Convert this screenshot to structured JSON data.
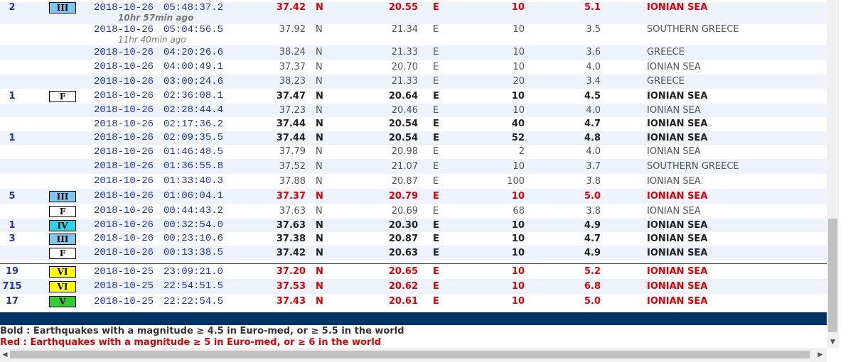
{
  "rows": [
    {
      "felt": "2",
      "intensity": "III",
      "int_color": "#7ec8f0",
      "date": "2018-10-26",
      "time": "05:48:37.2",
      "ago": "10hr 57min ago",
      "lat": "37.42",
      "ns": "N",
      "lon": "20.55",
      "ew": "E",
      "depth": "10",
      "mag": "5.1",
      "region": "IONIAN SEA",
      "style": "red"
    },
    {
      "felt": "",
      "intensity": "",
      "date": "2018-10-26",
      "time": "05:04:56.5",
      "ago": "11hr 40min ago",
      "lat": "37.92",
      "ns": "N",
      "lon": "21.34",
      "ew": "E",
      "depth": "10",
      "mag": "3.5",
      "region": "SOUTHERN GREECE",
      "style": "normal"
    },
    {
      "felt": "",
      "intensity": "",
      "date": "2018-10-26",
      "time": "04:20:26.6",
      "lat": "38.24",
      "ns": "N",
      "lon": "21.33",
      "ew": "E",
      "depth": "10",
      "mag": "3.6",
      "region": "GREECE",
      "style": "normal"
    },
    {
      "felt": "",
      "intensity": "",
      "date": "2018-10-26",
      "time": "04:00:49.1",
      "lat": "37.37",
      "ns": "N",
      "lon": "20.70",
      "ew": "E",
      "depth": "10",
      "mag": "4.0",
      "region": "IONIAN SEA",
      "style": "normal"
    },
    {
      "felt": "",
      "intensity": "",
      "date": "2018-10-26",
      "time": "03:00:24.6",
      "lat": "38.23",
      "ns": "N",
      "lon": "21.33",
      "ew": "E",
      "depth": "20",
      "mag": "3.4",
      "region": "GREECE",
      "style": "normal"
    },
    {
      "felt": "1",
      "intensity": "F",
      "int_color": "#ffffff",
      "date": "2018-10-26",
      "time": "02:36:08.1",
      "lat": "37.47",
      "ns": "N",
      "lon": "20.64",
      "ew": "E",
      "depth": "10",
      "mag": "4.5",
      "region": "IONIAN SEA",
      "style": "bold"
    },
    {
      "felt": "",
      "intensity": "",
      "date": "2018-10-26",
      "time": "02:28:44.4",
      "lat": "37.23",
      "ns": "N",
      "lon": "20.46",
      "ew": "E",
      "depth": "10",
      "mag": "4.0",
      "region": "IONIAN SEA",
      "style": "normal"
    },
    {
      "felt": "",
      "intensity": "",
      "date": "2018-10-26",
      "time": "02:17:36.2",
      "lat": "37.44",
      "ns": "N",
      "lon": "20.54",
      "ew": "E",
      "depth": "40",
      "mag": "4.7",
      "region": "IONIAN SEA",
      "style": "bold"
    },
    {
      "felt": "1",
      "intensity": "",
      "date": "2018-10-26",
      "time": "02:09:35.5",
      "lat": "37.44",
      "ns": "N",
      "lon": "20.54",
      "ew": "E",
      "depth": "52",
      "mag": "4.8",
      "region": "IONIAN SEA",
      "style": "bold"
    },
    {
      "felt": "",
      "intensity": "",
      "date": "2018-10-26",
      "time": "01:46:48.5",
      "lat": "37.79",
      "ns": "N",
      "lon": "20.98",
      "ew": "E",
      "depth": "2",
      "mag": "4.0",
      "region": "IONIAN SEA",
      "style": "normal"
    },
    {
      "felt": "",
      "intensity": "",
      "date": "2018-10-26",
      "time": "01:36:55.8",
      "lat": "37.52",
      "ns": "N",
      "lon": "21.07",
      "ew": "E",
      "depth": "10",
      "mag": "3.7",
      "region": "SOUTHERN GREECE",
      "style": "normal"
    },
    {
      "felt": "",
      "intensity": "",
      "date": "2018-10-26",
      "time": "01:33:40.3",
      "lat": "37.88",
      "ns": "N",
      "lon": "20.87",
      "ew": "E",
      "depth": "100",
      "mag": "3.8",
      "region": "IONIAN SEA",
      "style": "normal"
    },
    {
      "felt": "5",
      "intensity": "III",
      "int_color": "#7ec8f0",
      "date": "2018-10-26",
      "time": "01:06:04.1",
      "lat": "37.37",
      "ns": "N",
      "lon": "20.79",
      "ew": "E",
      "depth": "10",
      "mag": "5.0",
      "region": "IONIAN SEA",
      "style": "red"
    },
    {
      "felt": "",
      "intensity": "F",
      "int_color": "#ffffff",
      "date": "2018-10-26",
      "time": "00:44:43.2",
      "lat": "37.63",
      "ns": "N",
      "lon": "20.69",
      "ew": "E",
      "depth": "68",
      "mag": "3.8",
      "region": "IONIAN SEA",
      "style": "normal"
    },
    {
      "felt": "1",
      "intensity": "IV",
      "int_color": "#2ed2e8",
      "date": "2018-10-26",
      "time": "00:32:54.0",
      "lat": "37.63",
      "ns": "N",
      "lon": "20.30",
      "ew": "E",
      "depth": "10",
      "mag": "4.9",
      "region": "IONIAN SEA",
      "style": "bold"
    },
    {
      "felt": "3",
      "intensity": "III",
      "int_color": "#7ec8f0",
      "date": "2018-10-26",
      "time": "00:23:10.6",
      "lat": "37.38",
      "ns": "N",
      "lon": "20.87",
      "ew": "E",
      "depth": "10",
      "mag": "4.7",
      "region": "IONIAN SEA",
      "style": "bold"
    },
    {
      "felt": "",
      "intensity": "F",
      "int_color": "#ffffff",
      "date": "2018-10-26",
      "time": "00:13:38.5",
      "lat": "37.42",
      "ns": "N",
      "lon": "20.63",
      "ew": "E",
      "depth": "10",
      "mag": "4.9",
      "region": "IONIAN SEA",
      "style": "bold"
    },
    {
      "felt": "19",
      "intensity": "VI",
      "int_color": "#ffff00",
      "date": "2018-10-25",
      "time": "23:09:21.0",
      "lat": "37.20",
      "ns": "N",
      "lon": "20.65",
      "ew": "E",
      "depth": "10",
      "mag": "5.2",
      "region": "IONIAN SEA",
      "style": "red"
    },
    {
      "felt": "715",
      "intensity": "VI",
      "int_color": "#ffff00",
      "date": "2018-10-25",
      "time": "22:54:51.5",
      "lat": "37.53",
      "ns": "N",
      "lon": "20.62",
      "ew": "E",
      "depth": "10",
      "mag": "6.8",
      "region": "IONIAN SEA",
      "style": "red"
    },
    {
      "felt": "17",
      "intensity": "V",
      "int_color": "#33cc33",
      "date": "2018-10-25",
      "time": "22:22:54.5",
      "lat": "37.43",
      "ns": "N",
      "lon": "20.61",
      "ew": "E",
      "depth": "10",
      "mag": "5.0",
      "region": "IONIAN SEA",
      "style": "red"
    }
  ],
  "legend": {
    "bold": "Bold : Earthquakes with a magnitude ≥ 4.5 in Euro-med, or ≥ 5.5 in the world",
    "red": "Red : Earthquakes with a magnitude ≥ 5 in Euro-med, or ≥ 6 in the world"
  },
  "scrollbars": {
    "left_arrow": "◀",
    "right_arrow": "▶",
    "down_arrow": "▼"
  }
}
